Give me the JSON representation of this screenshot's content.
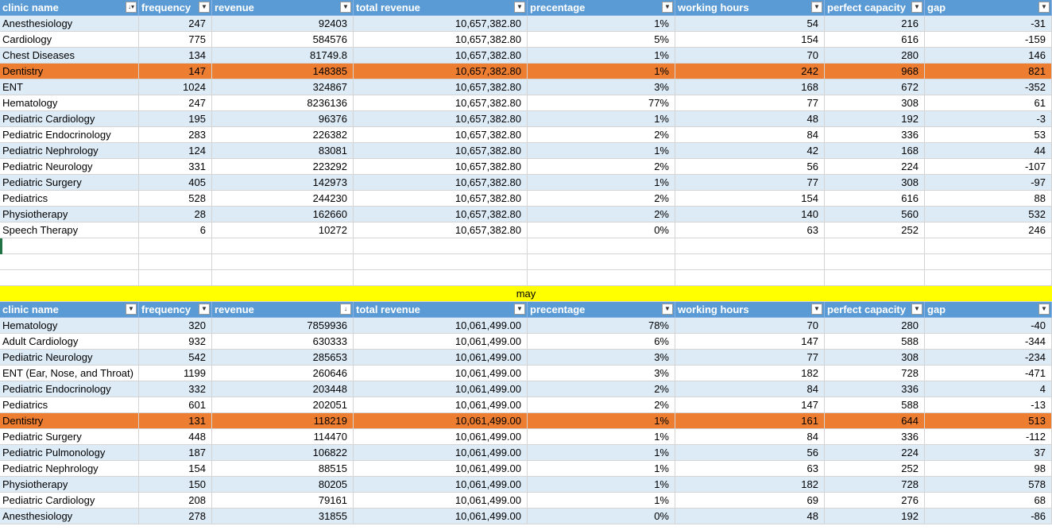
{
  "tables": [
    {
      "headers": [
        "clinic name",
        "frequency",
        "revenue",
        "total revenue",
        "precentage",
        "working hours",
        "perfect capacity",
        "gap"
      ],
      "sort_icons": [
        "sort-filter-icon",
        "dropdown-icon",
        "dropdown-icon",
        "dropdown-icon",
        "dropdown-icon",
        "dropdown-icon",
        "dropdown-icon",
        "dropdown-icon"
      ],
      "rows": [
        [
          "Anesthesiology",
          "247",
          "92403",
          "10,657,382.80",
          "1%",
          "54",
          "216",
          "-31"
        ],
        [
          "Cardiology",
          "775",
          "584576",
          "10,657,382.80",
          "5%",
          "154",
          "616",
          "-159"
        ],
        [
          "Chest Diseases",
          "134",
          "81749.8",
          "10,657,382.80",
          "1%",
          "70",
          "280",
          "146"
        ],
        [
          "Dentistry",
          "147",
          "148385",
          "10,657,382.80",
          "1%",
          "242",
          "968",
          "821"
        ],
        [
          "ENT",
          "1024",
          "324867",
          "10,657,382.80",
          "3%",
          "168",
          "672",
          "-352"
        ],
        [
          "Hematology",
          "247",
          "8236136",
          "10,657,382.80",
          "77%",
          "77",
          "308",
          "61"
        ],
        [
          "Pediatric Cardiology",
          "195",
          "96376",
          "10,657,382.80",
          "1%",
          "48",
          "192",
          "-3"
        ],
        [
          "Pediatric Endocrinology",
          "283",
          "226382",
          "10,657,382.80",
          "2%",
          "84",
          "336",
          "53"
        ],
        [
          "Pediatric Nephrology",
          "124",
          "83081",
          "10,657,382.80",
          "1%",
          "42",
          "168",
          "44"
        ],
        [
          "Pediatric Neurology",
          "331",
          "223292",
          "10,657,382.80",
          "2%",
          "56",
          "224",
          "-107"
        ],
        [
          "Pediatric Surgery",
          "405",
          "142973",
          "10,657,382.80",
          "1%",
          "77",
          "308",
          "-97"
        ],
        [
          "Pediatrics",
          "528",
          "244230",
          "10,657,382.80",
          "2%",
          "154",
          "616",
          "88"
        ],
        [
          "Physiotherapy",
          "28",
          "162660",
          "10,657,382.80",
          "2%",
          "140",
          "560",
          "532"
        ],
        [
          "Speech Therapy",
          "6",
          "10272",
          "10,657,382.80",
          "0%",
          "63",
          "252",
          "246"
        ]
      ],
      "highlight_row": 3
    },
    {
      "label": "may",
      "headers": [
        "clinic name",
        "frequency",
        "revenue",
        "total revenue",
        "precentage",
        "working hours",
        "perfect capacity",
        "gap"
      ],
      "sort_icons": [
        "dropdown-icon",
        "dropdown-icon",
        "sort-desc-icon",
        "dropdown-icon",
        "dropdown-icon",
        "dropdown-icon",
        "dropdown-icon",
        "dropdown-icon"
      ],
      "rows": [
        [
          "Hematology",
          "320",
          "7859936",
          "10,061,499.00",
          "78%",
          "70",
          "280",
          "-40"
        ],
        [
          "Adult Cardiology",
          "932",
          "630333",
          "10,061,499.00",
          "6%",
          "147",
          "588",
          "-344"
        ],
        [
          "Pediatric Neurology",
          "542",
          "285653",
          "10,061,499.00",
          "3%",
          "77",
          "308",
          "-234"
        ],
        [
          "ENT (Ear, Nose, and Throat)",
          "1199",
          "260646",
          "10,061,499.00",
          "3%",
          "182",
          "728",
          "-471"
        ],
        [
          "Pediatric Endocrinology",
          "332",
          "203448",
          "10,061,499.00",
          "2%",
          "84",
          "336",
          "4"
        ],
        [
          "Pediatrics",
          "601",
          "202051",
          "10,061,499.00",
          "2%",
          "147",
          "588",
          "-13"
        ],
        [
          "Dentistry",
          "131",
          "118219",
          "10,061,499.00",
          "1%",
          "161",
          "644",
          "513"
        ],
        [
          "Pediatric Surgery",
          "448",
          "114470",
          "10,061,499.00",
          "1%",
          "84",
          "336",
          "-112"
        ],
        [
          "Pediatric Pulmonology",
          "187",
          "106822",
          "10,061,499.00",
          "1%",
          "56",
          "224",
          "37"
        ],
        [
          "Pediatric Nephrology",
          "154",
          "88515",
          "10,061,499.00",
          "1%",
          "63",
          "252",
          "98"
        ],
        [
          "Physiotherapy",
          "150",
          "80205",
          "10,061,499.00",
          "1%",
          "182",
          "728",
          "578"
        ],
        [
          "Pediatric Cardiology",
          "208",
          "79161",
          "10,061,499.00",
          "1%",
          "69",
          "276",
          "68"
        ],
        [
          "Anesthesiology",
          "278",
          "31855",
          "10,061,499.00",
          "0%",
          "48",
          "192",
          "-86"
        ]
      ],
      "highlight_row": 6
    }
  ],
  "colors": {
    "header": "#5b9bd5",
    "band": "#ddebf7",
    "highlight": "#ed7d31",
    "may_bar": "#ffff00"
  }
}
